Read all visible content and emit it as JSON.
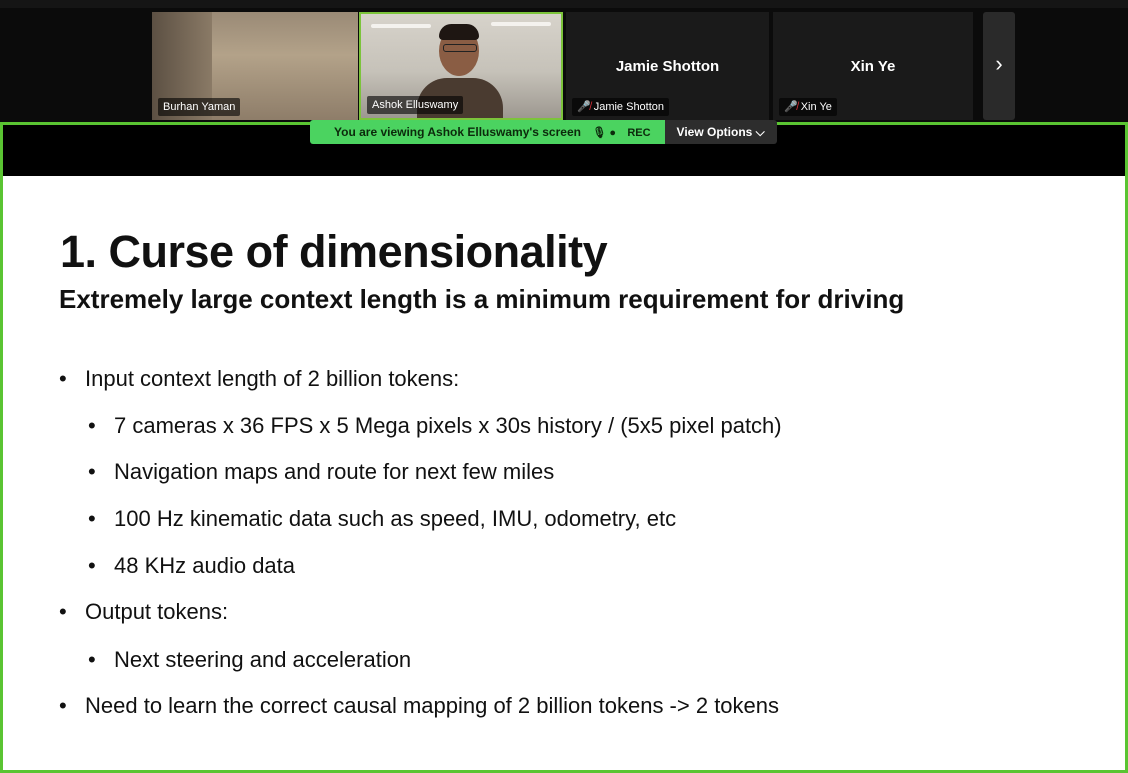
{
  "gallery": {
    "participants": [
      {
        "name": "Burhan Yaman",
        "muted": false
      },
      {
        "name": "Ashok Elluswamy",
        "muted": false
      },
      {
        "name": "Jamie Shotton",
        "muted": true,
        "center_label": "Jamie Shotton"
      },
      {
        "name": "Xin Ye",
        "muted": true,
        "center_label": "Xin Ye"
      }
    ],
    "next_label": "›"
  },
  "share_bar": {
    "viewing_text": "You are viewing  Ashok Elluswamy's screen",
    "rec_label": "REC",
    "view_options_label": "View Options ⌵"
  },
  "slide": {
    "title": "1. Curse of dimensionality",
    "subtitle": "Extremely large context length is a minimum requirement for driving",
    "bullets": [
      {
        "text": "Input context length of 2 billion tokens:",
        "level": 1
      },
      {
        "text": "7 cameras x 36 FPS x 5 Mega pixels x 30s history / (5x5 pixel patch)",
        "level": 2
      },
      {
        "text": "Navigation maps and route for next few miles",
        "level": 2
      },
      {
        "text": "100 Hz kinematic data such as speed, IMU, odometry, etc",
        "level": 2
      },
      {
        "text": "48 KHz audio data",
        "level": 2
      },
      {
        "text": "Output tokens:",
        "level": 1
      },
      {
        "text": "Next steering and acceleration",
        "level": 2
      },
      {
        "text": "Need to learn the correct causal mapping of 2 billion tokens -> 2 tokens",
        "level": 1
      }
    ]
  },
  "colors": {
    "accent_green": "#5ac432",
    "viewing_green": "#4bd360",
    "muted_red": "#e0303a"
  }
}
